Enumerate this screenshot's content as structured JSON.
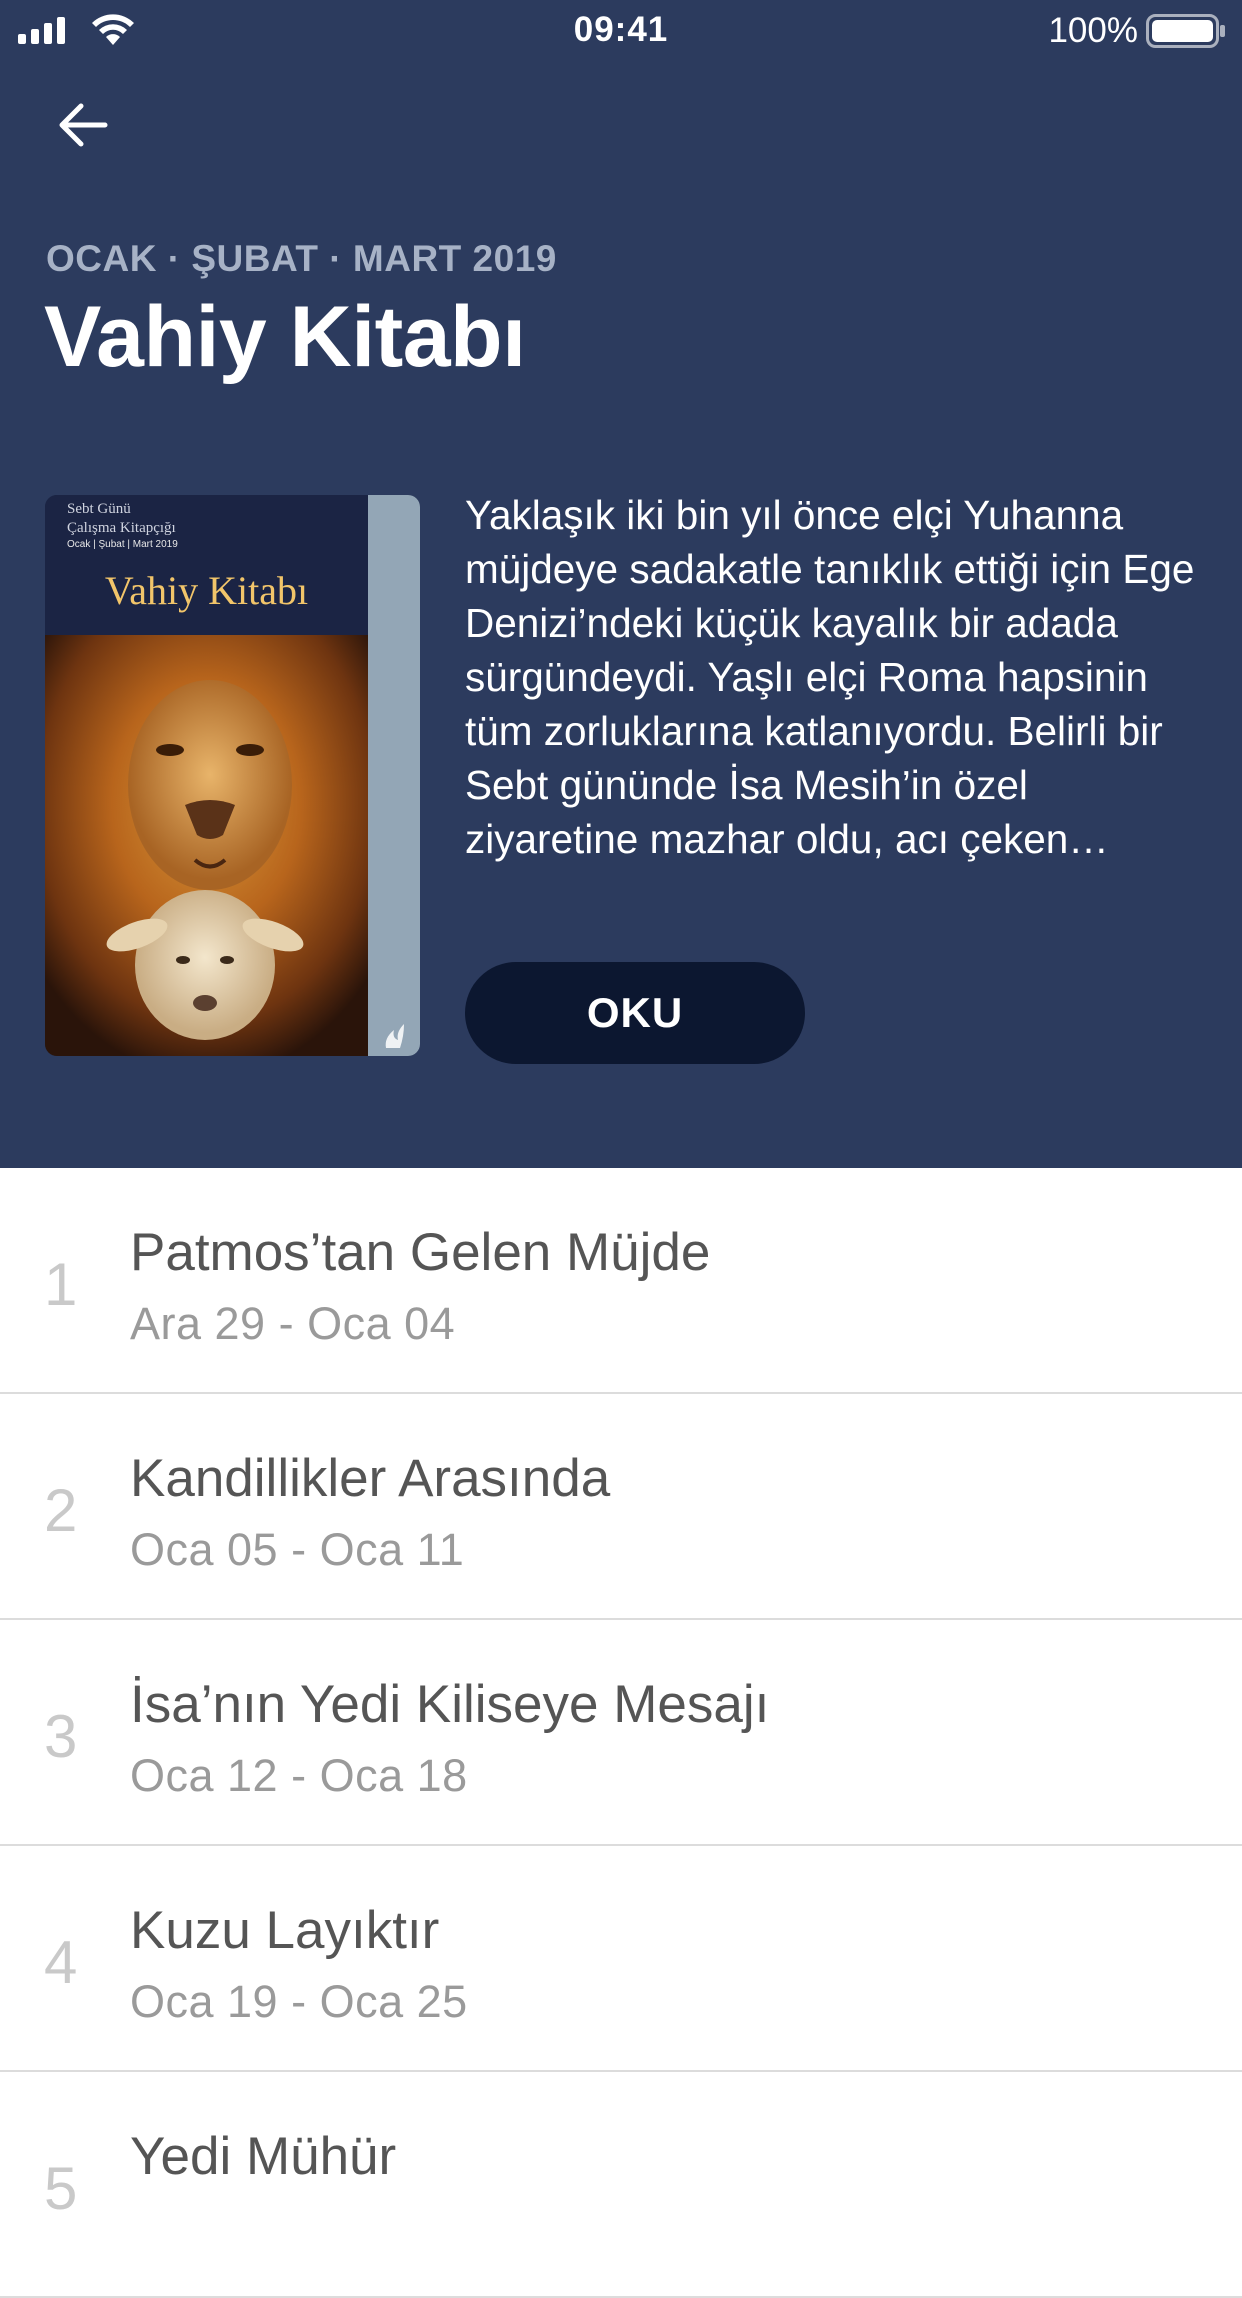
{
  "status_bar": {
    "time": "09:41",
    "battery_percent": "100%",
    "icons": [
      "cellular-signal-icon",
      "wifi-icon",
      "battery-icon"
    ]
  },
  "header": {
    "back_icon": "arrow-left-icon",
    "subtitle": "OCAK · ŞUBAT · MART 2019",
    "title": "Vahiy Kitabı",
    "background_color": "#2c3b5e"
  },
  "cover": {
    "line1": "Sebt Günü",
    "line2": "Çalışma Kitapçığı",
    "line3": "Ocak | Şubat | Mart 2019",
    "title": "Vahiy Kitabı"
  },
  "description": "Yaklaşık iki bin yıl önce elçi Yuhanna müjdeye sadakatle tanıklık ettiği için Ege Denizi’ndeki küçük kayalık bir adada sürgündeydi. Yaşlı elçi Roma hapsinin tüm zorluklarına katlanıyordu. Belirli bir Sebt gününde İsa Mesih’in özel ziyaretine mazhar oldu, acı çeken…",
  "read_button": {
    "label": "OKU",
    "color": "#0c1730"
  },
  "lessons": [
    {
      "number": "1",
      "title": "Patmos’tan Gelen Müjde",
      "dates": "Ara 29 - Oca 04"
    },
    {
      "number": "2",
      "title": "Kandillikler Arasında",
      "dates": "Oca 05 - Oca 11"
    },
    {
      "number": "3",
      "title": "İsa’nın Yedi Kiliseye Mesajı",
      "dates": "Oca 12 - Oca 18"
    },
    {
      "number": "4",
      "title": "Kuzu Layıktır",
      "dates": "Oca 19 - Oca 25"
    },
    {
      "number": "5",
      "title": "Yedi Mühür",
      "dates": ""
    }
  ]
}
